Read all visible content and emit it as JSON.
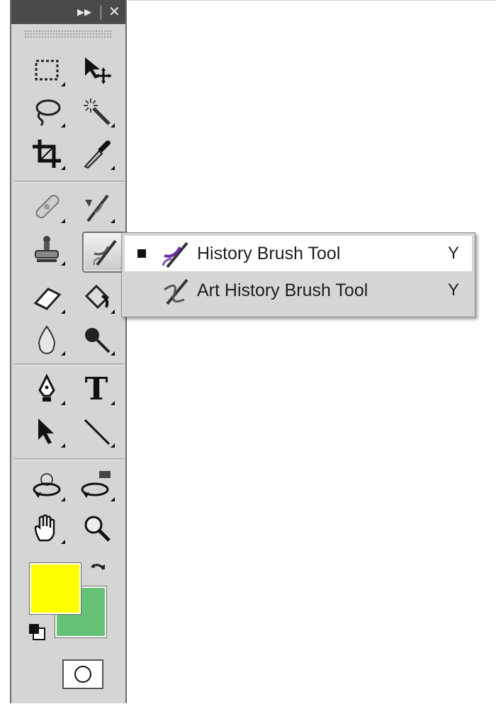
{
  "window": {
    "collapse_glyph": "▸▸",
    "divider_glyph": "|",
    "close_glyph": "✕"
  },
  "tools": [
    {
      "name": "rectangular-marquee-icon"
    },
    {
      "name": "move-icon"
    },
    {
      "name": "lasso-icon"
    },
    {
      "name": "magic-wand-icon"
    },
    {
      "name": "crop-icon"
    },
    {
      "name": "eyedropper-icon"
    },
    {
      "name": "healing-brush-icon"
    },
    {
      "name": "brush-icon"
    },
    {
      "name": "clone-stamp-icon"
    },
    {
      "name": "history-brush-icon",
      "active": true
    },
    {
      "name": "eraser-icon"
    },
    {
      "name": "paint-bucket-icon"
    },
    {
      "name": "blur-icon"
    },
    {
      "name": "dodge-icon"
    },
    {
      "name": "pen-icon"
    },
    {
      "name": "type-icon",
      "glyph": "T"
    },
    {
      "name": "path-selection-icon"
    },
    {
      "name": "line-icon"
    },
    {
      "name": "3d-rotate-icon"
    },
    {
      "name": "3d-camera-rotate-icon"
    },
    {
      "name": "hand-icon"
    },
    {
      "name": "zoom-icon"
    }
  ],
  "flyout": {
    "items": [
      {
        "label": "History Brush Tool",
        "shortcut": "Y",
        "selected": true,
        "icon": "history-brush-icon"
      },
      {
        "label": "Art History Brush Tool",
        "shortcut": "Y",
        "selected": false,
        "icon": "art-history-brush-icon"
      }
    ]
  },
  "colors": {
    "foreground": "#ffff00",
    "background": "#66c274",
    "toolbar_bg": "#d5d5d5",
    "title_bar": "#4a4a4a"
  }
}
